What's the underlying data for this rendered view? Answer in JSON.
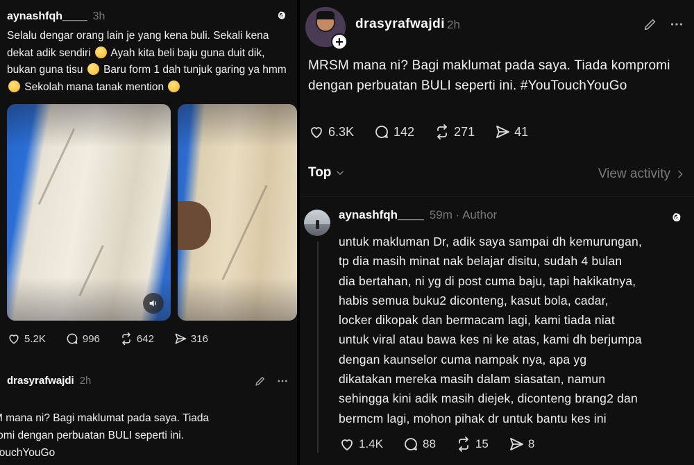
{
  "left_post": {
    "username": "aynashfqh____",
    "time": "3h",
    "text_parts": [
      "Selalu dengar orang lain je yang kena buli. Sekali kena dekat adik sendiri ",
      " Ayah kita beli baju guna duit dik, bukan guna tisu ",
      " Baru form 1 dah tunjuk garing ya hmm ",
      " Sekolah mana tanak mention "
    ],
    "stats": {
      "likes": "5.2K",
      "replies": "996",
      "reposts": "642",
      "shares": "316"
    }
  },
  "left_quoted_post": {
    "username": "drasyrafwajdi",
    "time": "2h",
    "lines": [
      "M mana ni? Bagi maklumat pada saya. Tiada",
      "romi dengan perbuatan BULI seperti ini.",
      "TouchYouGo"
    ]
  },
  "main_post": {
    "username": "drasyrafwajdi",
    "time": "2h",
    "text": "MRSM mana ni? Bagi maklumat pada saya. Tiada kompromi dengan perbuatan BULI seperti ini. #YouTouchYouGo",
    "stats": {
      "likes": "6.3K",
      "replies": "142",
      "reposts": "271",
      "shares": "41"
    }
  },
  "sort": {
    "label": "Top",
    "view_activity": "View activity"
  },
  "reply": {
    "username": "aynashfqh____",
    "time": "59m",
    "badge": "Author",
    "lines": [
      "untuk makluman Dr, adik saya sampai dh kemurungan,",
      "tp dia masih minat nak belajar disitu, sudah 4 bulan",
      "dia bertahan, ni yg di post cuma baju, tapi hakikatnya,",
      "habis semua buku2 diconteng, kasut bola, cadar,",
      "locker dikopak dan bermacam lagi, kami tiada niat",
      "untuk viral atau bawa kes ni ke atas, kami dh berjumpa",
      "dengan kaunselor cuma nampak nya, apa yg",
      "dikatakan mereka masih dalam siasatan, namun",
      "sehingga kini adik masih diejek, diconteng brang2 dan",
      "bermcm lagi, mohon pihak dr untuk bantu kes ini"
    ],
    "stats": {
      "likes": "1.4K",
      "replies": "88",
      "reposts": "15",
      "shares": "8"
    }
  },
  "icons": {
    "like": "heart-icon",
    "reply": "comment-icon",
    "repost": "repost-icon",
    "share": "send-icon",
    "threads": "threads-logo-icon",
    "edit": "pencil-icon",
    "more": "more-icon",
    "sound": "speaker-icon"
  }
}
